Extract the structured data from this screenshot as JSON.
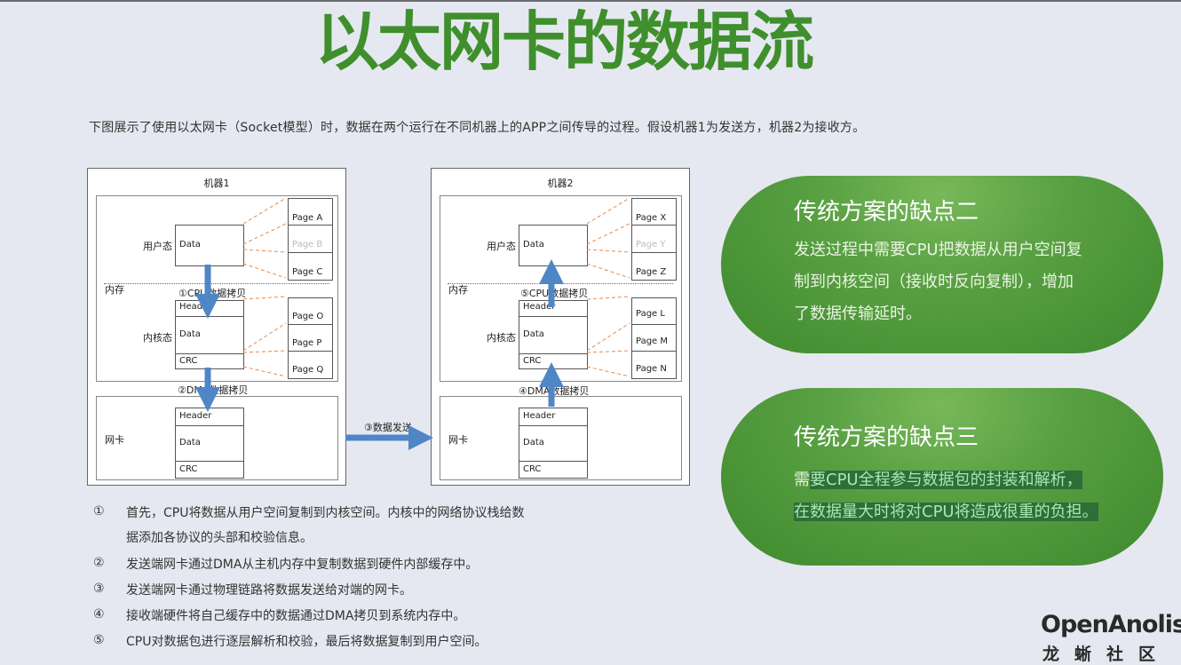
{
  "title": "以太网卡的数据流",
  "intro": "下图展示了使用以太网卡（Socket模型）时，数据在两个运行在不同机器上的APP之间传导的过程。假设机器1为发送方，机器2为接收方。",
  "diagram": {
    "machine1": {
      "title": "机器1",
      "memory_label": "内存",
      "user_label": "用户态",
      "kernel_label": "内核态",
      "nic_label": "网卡",
      "user_data": "Data",
      "kernel_cells": [
        "Header",
        "Data",
        "CRC"
      ],
      "nic_cells": [
        "Header",
        "Data",
        "CRC"
      ],
      "user_pages": [
        "Page A",
        "Page B",
        "Page C"
      ],
      "kernel_pages": [
        "Page O",
        "Page P",
        "Page Q"
      ],
      "step_cpu": "①CPU数据拷贝",
      "step_dma": "②DMA数据拷贝"
    },
    "machine2": {
      "title": "机器2",
      "memory_label": "内存",
      "user_label": "用户态",
      "kernel_label": "内核态",
      "nic_label": "网卡",
      "user_data": "Data",
      "kernel_cells": [
        "Header",
        "Data",
        "CRC"
      ],
      "nic_cells": [
        "Header",
        "Data",
        "CRC"
      ],
      "user_pages": [
        "Page X",
        "Page Y",
        "Page Z"
      ],
      "kernel_pages": [
        "Page L",
        "Page M",
        "Page N"
      ],
      "step_cpu": "⑤CPU数据拷贝",
      "step_dma": "④DMA数据拷贝"
    },
    "step_send": "③数据发送"
  },
  "cards": [
    {
      "title": "传统方案的缺点二",
      "lines": [
        "发送过程中需要CPU把数据从用户空间复",
        "制到内核空间（接收时反向复制），增加",
        "了数据传输延时。"
      ]
    },
    {
      "title": "传统方案的缺点三",
      "line1_plain": "需",
      "line1_hl": "要CPU全程参与数据包的封装和解析，",
      "line2_hl": "在数据量大时将对CPU将造成很重的负担。"
    }
  ],
  "notes": [
    {
      "num": "①",
      "text": "首先，CPU将数据从用户空间复制到内核空间。内核中的网络协议栈给数据添加各协议的头部和校验信息。"
    },
    {
      "num": "②",
      "text": "发送端网卡通过DMA从主机内存中复制数据到硬件内部缓存中。"
    },
    {
      "num": "③",
      "text": "发送端网卡通过物理链路将数据发送给对端的网卡。"
    },
    {
      "num": "④",
      "text": "接收端硬件将自己缓存中的数据通过DMA拷贝到系统内存中。"
    },
    {
      "num": "⑤",
      "text": "CPU对数据包进行逐层解析和校验，最后将数据复制到用户空间。"
    }
  ],
  "logo": {
    "line1": "OpenAnolis",
    "line2": "龙蜥社区"
  },
  "colors": {
    "title": "#3f8f2d",
    "arrow": "#4f86c6",
    "dash": "#e8894a",
    "pill": "#58a042"
  }
}
